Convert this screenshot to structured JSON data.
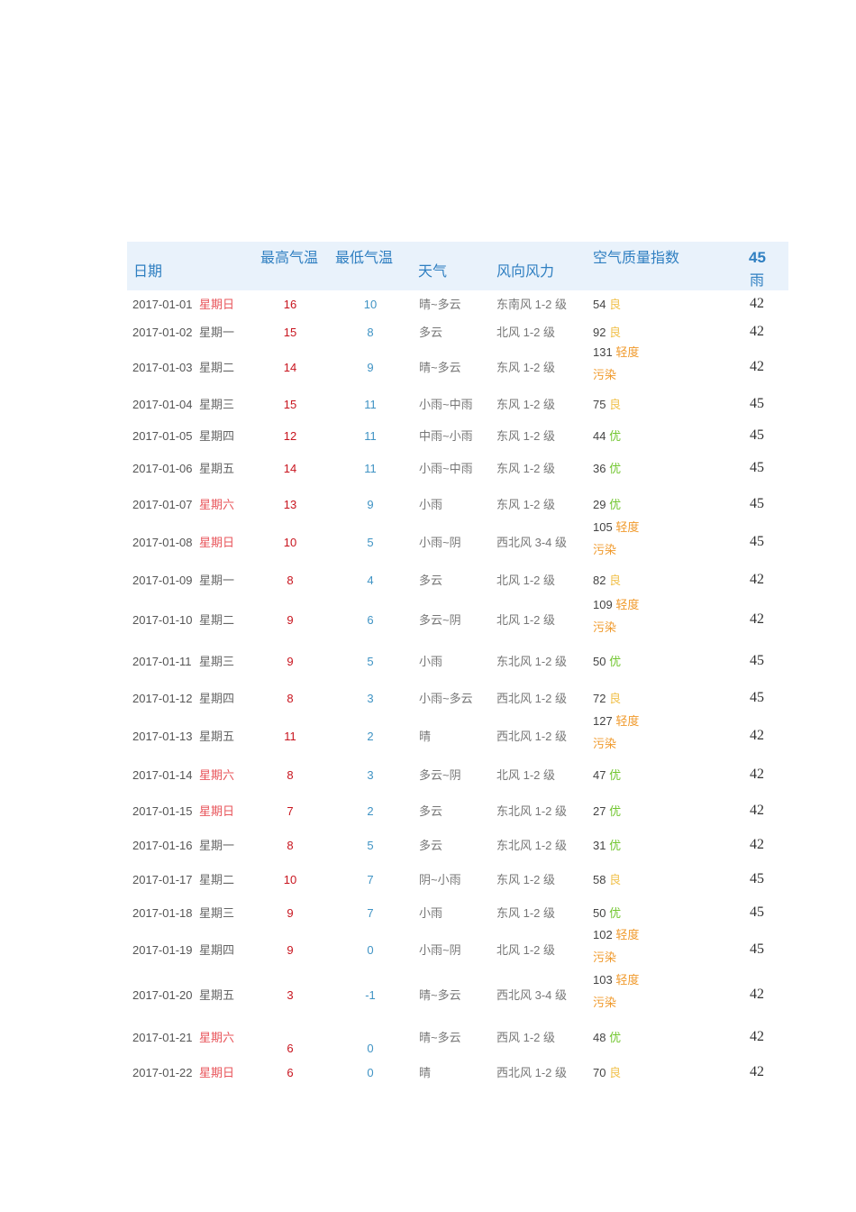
{
  "header": {
    "date": "日期",
    "max": "最高气温",
    "min": "最低气温",
    "weather": "天气",
    "wind": "风向风力",
    "aqi": "空气质量指数",
    "last_num": "45",
    "last_text": "雨"
  },
  "colors": {
    "header_bg": "#e9f2fb",
    "header_text": "#2f7fc1",
    "max": "#c8141e",
    "min": "#3f93c4",
    "weekend": "#e8545a"
  },
  "rows": [
    {
      "date": "2017-01-01",
      "weekday": "星期日",
      "weekend": true,
      "max": "16",
      "min": "10",
      "weather": "晴~多云",
      "wind": "东南风 1-2 级",
      "aqi": "54",
      "level": "良",
      "level2": "",
      "lvl": "good",
      "last": "42"
    },
    {
      "date": "2017-01-02",
      "weekday": "星期一",
      "weekend": false,
      "max": "15",
      "min": "8",
      "weather": "多云",
      "wind": "北风 1-2 级",
      "aqi": "92",
      "level": "良",
      "level2": "",
      "lvl": "good",
      "last": "42"
    },
    {
      "date": "2017-01-03",
      "weekday": "星期二",
      "weekend": false,
      "max": "14",
      "min": "9",
      "weather": "晴~多云",
      "wind": "东风 1-2 级",
      "aqi": "131",
      "level": "轻度",
      "level2": "污染",
      "lvl": "light",
      "last": "42"
    },
    {
      "date": "2017-01-04",
      "weekday": "星期三",
      "weekend": false,
      "max": "15",
      "min": "11",
      "weather": "小雨~中雨",
      "wind": "东风 1-2 级",
      "aqi": "75",
      "level": "良",
      "level2": "",
      "lvl": "good",
      "last": "45"
    },
    {
      "date": "2017-01-05",
      "weekday": "星期四",
      "weekend": false,
      "max": "12",
      "min": "11",
      "weather": "中雨~小雨",
      "wind": "东风 1-2 级",
      "aqi": "44",
      "level": "优",
      "level2": "",
      "lvl": "excellent",
      "last": "45"
    },
    {
      "date": "2017-01-06",
      "weekday": "星期五",
      "weekend": false,
      "max": "14",
      "min": "11",
      "weather": "小雨~中雨",
      "wind": "东风 1-2 级",
      "aqi": "36",
      "level": "优",
      "level2": "",
      "lvl": "excellent",
      "last": "45"
    },
    {
      "date": "2017-01-07",
      "weekday": "星期六",
      "weekend": true,
      "max": "13",
      "min": "9",
      "weather": "小雨",
      "wind": "东风 1-2 级",
      "aqi": "29",
      "level": "优",
      "level2": "",
      "lvl": "excellent",
      "last": "45"
    },
    {
      "date": "2017-01-08",
      "weekday": "星期日",
      "weekend": true,
      "max": "10",
      "min": "5",
      "weather": "小雨~阴",
      "wind": "西北风 3-4 级",
      "aqi": "105",
      "level": "轻度",
      "level2": "污染",
      "lvl": "light",
      "last": "45"
    },
    {
      "date": "2017-01-09",
      "weekday": "星期一",
      "weekend": false,
      "max": "8",
      "min": "4",
      "weather": "多云",
      "wind": "北风 1-2 级",
      "aqi": "82",
      "level": "良",
      "level2": "",
      "lvl": "good",
      "last": "42"
    },
    {
      "date": "2017-01-10",
      "weekday": "星期二",
      "weekend": false,
      "max": "9",
      "min": "6",
      "weather": "多云~阴",
      "wind": "北风 1-2 级",
      "aqi": "109",
      "level": "轻度",
      "level2": "污染",
      "lvl": "light",
      "last": "42"
    },
    {
      "date": "2017-01-11",
      "weekday": "星期三",
      "weekend": false,
      "max": "9",
      "min": "5",
      "weather": "小雨",
      "wind": "东北风 1-2 级",
      "aqi": "50",
      "level": "优",
      "level2": "",
      "lvl": "excellent",
      "last": "45"
    },
    {
      "date": "2017-01-12",
      "weekday": "星期四",
      "weekend": false,
      "max": "8",
      "min": "3",
      "weather": "小雨~多云",
      "wind": "西北风 1-2 级",
      "aqi": "72",
      "level": "良",
      "level2": "",
      "lvl": "good",
      "last": "45"
    },
    {
      "date": "2017-01-13",
      "weekday": "星期五",
      "weekend": false,
      "max": "11",
      "min": "2",
      "weather": "晴",
      "wind": "西北风 1-2 级",
      "aqi": "127",
      "level": "轻度",
      "level2": "污染",
      "lvl": "light",
      "last": "42"
    },
    {
      "date": "2017-01-14",
      "weekday": "星期六",
      "weekend": true,
      "max": "8",
      "min": "3",
      "weather": "多云~阴",
      "wind": "北风 1-2 级",
      "aqi": "47",
      "level": "优",
      "level2": "",
      "lvl": "excellent",
      "last": "42"
    },
    {
      "date": "2017-01-15",
      "weekday": "星期日",
      "weekend": true,
      "max": "7",
      "min": "2",
      "weather": "多云",
      "wind": "东北风 1-2 级",
      "aqi": "27",
      "level": "优",
      "level2": "",
      "lvl": "excellent",
      "last": "42"
    },
    {
      "date": "2017-01-16",
      "weekday": "星期一",
      "weekend": false,
      "max": "8",
      "min": "5",
      "weather": "多云",
      "wind": "东北风 1-2 级",
      "aqi": "31",
      "level": "优",
      "level2": "",
      "lvl": "excellent",
      "last": "42"
    },
    {
      "date": "2017-01-17",
      "weekday": "星期二",
      "weekend": false,
      "max": "10",
      "min": "7",
      "weather": "阴~小雨",
      "wind": "东风 1-2 级",
      "aqi": "58",
      "level": "良",
      "level2": "",
      "lvl": "good",
      "last": "45"
    },
    {
      "date": "2017-01-18",
      "weekday": "星期三",
      "weekend": false,
      "max": "9",
      "min": "7",
      "weather": "小雨",
      "wind": "东风 1-2 级",
      "aqi": "50",
      "level": "优",
      "level2": "",
      "lvl": "excellent",
      "last": "45"
    },
    {
      "date": "2017-01-19",
      "weekday": "星期四",
      "weekend": false,
      "max": "9",
      "min": "0",
      "weather": "小雨~阴",
      "wind": "北风 1-2 级",
      "aqi": "102",
      "level": "轻度",
      "level2": "污染",
      "lvl": "light",
      "last": "45"
    },
    {
      "date": "2017-01-20",
      "weekday": "星期五",
      "weekend": false,
      "max": "3",
      "min": "-1",
      "weather": "晴~多云",
      "wind": "西北风 3-4 级",
      "aqi": "103",
      "level": "轻度",
      "level2": "污染",
      "lvl": "light",
      "last": "42"
    },
    {
      "date": "2017-01-21",
      "weekday": "星期六",
      "weekend": true,
      "max": "6",
      "min": "0",
      "weather": "晴~多云",
      "wind": "西风 1-2 级",
      "aqi": "48",
      "level": "优",
      "level2": "",
      "lvl": "excellent",
      "last": "42"
    },
    {
      "date": "2017-01-22",
      "weekday": "星期日",
      "weekend": true,
      "max": "6",
      "min": "0",
      "weather": "晴",
      "wind": "西北风 1-2 级",
      "aqi": "70",
      "level": "良",
      "level2": "",
      "lvl": "good",
      "last": "42"
    }
  ]
}
